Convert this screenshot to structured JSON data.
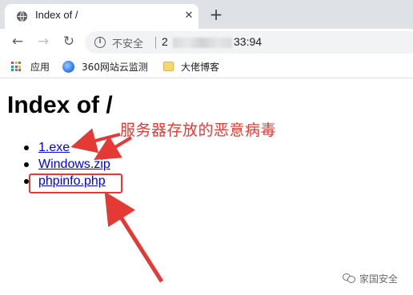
{
  "browser": {
    "tab": {
      "title": "Index of /",
      "close_glyph": "✕",
      "favicon": "globe-icon"
    },
    "new_tab_glyph": "+",
    "nav": {
      "back_glyph": "←",
      "forward_glyph": "→",
      "reload_glyph": "↻"
    },
    "omnibox": {
      "security_label": "不安全",
      "url_start": "2",
      "url_end": "33:94",
      "info_glyph": "i"
    },
    "bookmarks": [
      {
        "label": "应用",
        "icon": "apps-grid-icon"
      },
      {
        "label": "360网站云监测",
        "icon": "360-icon"
      },
      {
        "label": "大佬博客",
        "icon": "folder-icon"
      }
    ]
  },
  "page": {
    "title": "Index of /",
    "files": [
      {
        "name": "1.exe"
      },
      {
        "name": "Windows.zip"
      },
      {
        "name": "phpinfo.php"
      }
    ]
  },
  "annotation": {
    "text": "服务器存放的恶意病毒",
    "color": "#e53935"
  },
  "watermark": {
    "text": "家国安全"
  },
  "colors": {
    "tabstrip": "#dee1e6",
    "link": "#0000ee",
    "annotation_red": "#e53935",
    "apps_grid": [
      "#ea4335",
      "#fbbc05",
      "#34a853",
      "#4285f4",
      "#ea4335",
      "#fbbc05",
      "#34a853",
      "#4285f4",
      "#ea4335"
    ]
  }
}
